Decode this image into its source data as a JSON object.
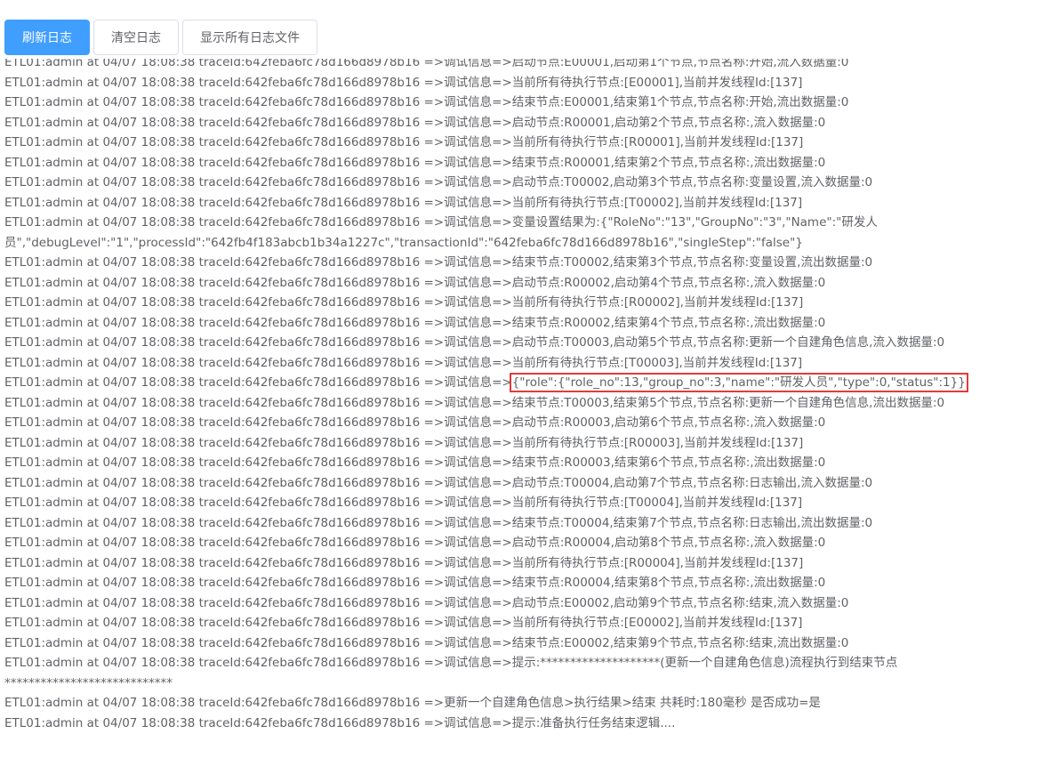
{
  "toolbar": {
    "refresh_label": "刷新日志",
    "clear_label": "清空日志",
    "show_all_label": "显示所有日志文件",
    "primary_color": "#409eff"
  },
  "log": {
    "highlight_color": "#e33b3b",
    "line_prefix": "ETL01:admin at 04/07 18:08:38 traceId:642feba6fc78d166d8978b16 =>",
    "highlight_text": "{\"role\":{\"role_no\":13,\"group_no\":3,\"name\":\"研发人员\",\"type\":0,\"status\":1}}",
    "lines": [
      "ETL01:admin at 04/07 18:08:38 traceId:642feba6fc78d166d8978b16 =>调试信息=>启动节点:E00001,启动第1个节点,节点名称:开始,流入数据量:0",
      "ETL01:admin at 04/07 18:08:38 traceId:642feba6fc78d166d8978b16 =>调试信息=>当前所有待执行节点:[E00001],当前并发线程Id:[137]",
      "ETL01:admin at 04/07 18:08:38 traceId:642feba6fc78d166d8978b16 =>调试信息=>结束节点:E00001,结束第1个节点,节点名称:开始,流出数据量:0",
      "ETL01:admin at 04/07 18:08:38 traceId:642feba6fc78d166d8978b16 =>调试信息=>启动节点:R00001,启动第2个节点,节点名称:,流入数据量:0",
      "ETL01:admin at 04/07 18:08:38 traceId:642feba6fc78d166d8978b16 =>调试信息=>当前所有待执行节点:[R00001],当前并发线程Id:[137]",
      "ETL01:admin at 04/07 18:08:38 traceId:642feba6fc78d166d8978b16 =>调试信息=>结束节点:R00001,结束第2个节点,节点名称:,流出数据量:0",
      "ETL01:admin at 04/07 18:08:38 traceId:642feba6fc78d166d8978b16 =>调试信息=>启动节点:T00002,启动第3个节点,节点名称:变量设置,流入数据量:0",
      "ETL01:admin at 04/07 18:08:38 traceId:642feba6fc78d166d8978b16 =>调试信息=>当前所有待执行节点:[T00002],当前并发线程Id:[137]",
      "ETL01:admin at 04/07 18:08:38 traceId:642feba6fc78d166d8978b16 =>调试信息=>变量设置结果为:{\"RoleNo\":\"13\",\"GroupNo\":\"3\",\"Name\":\"研发人",
      "员\",\"debugLevel\":\"1\",\"processId\":\"642fb4f183abcb1b34a1227c\",\"transactionId\":\"642feba6fc78d166d8978b16\",\"singleStep\":\"false\"}",
      "ETL01:admin at 04/07 18:08:38 traceId:642feba6fc78d166d8978b16 =>调试信息=>结束节点:T00002,结束第3个节点,节点名称:变量设置,流出数据量:0",
      "ETL01:admin at 04/07 18:08:38 traceId:642feba6fc78d166d8978b16 =>调试信息=>启动节点:R00002,启动第4个节点,节点名称:,流入数据量:0",
      "ETL01:admin at 04/07 18:08:38 traceId:642feba6fc78d166d8978b16 =>调试信息=>当前所有待执行节点:[R00002],当前并发线程Id:[137]",
      "ETL01:admin at 04/07 18:08:38 traceId:642feba6fc78d166d8978b16 =>调试信息=>结束节点:R00002,结束第4个节点,节点名称:,流出数据量:0",
      "ETL01:admin at 04/07 18:08:38 traceId:642feba6fc78d166d8978b16 =>调试信息=>启动节点:T00003,启动第5个节点,节点名称:更新一个自建角色信息,流入数据量:0",
      "ETL01:admin at 04/07 18:08:38 traceId:642feba6fc78d166d8978b16 =>调试信息=>当前所有待执行节点:[T00003],当前并发线程Id:[137]",
      "__HIGHLIGHT__",
      "ETL01:admin at 04/07 18:08:38 traceId:642feba6fc78d166d8978b16 =>调试信息=>结束节点:T00003,结束第5个节点,节点名称:更新一个自建角色信息,流出数据量:0",
      "ETL01:admin at 04/07 18:08:38 traceId:642feba6fc78d166d8978b16 =>调试信息=>启动节点:R00003,启动第6个节点,节点名称:,流入数据量:0",
      "ETL01:admin at 04/07 18:08:38 traceId:642feba6fc78d166d8978b16 =>调试信息=>当前所有待执行节点:[R00003],当前并发线程Id:[137]",
      "ETL01:admin at 04/07 18:08:38 traceId:642feba6fc78d166d8978b16 =>调试信息=>结束节点:R00003,结束第6个节点,节点名称:,流出数据量:0",
      "ETL01:admin at 04/07 18:08:38 traceId:642feba6fc78d166d8978b16 =>调试信息=>启动节点:T00004,启动第7个节点,节点名称:日志输出,流入数据量:0",
      "ETL01:admin at 04/07 18:08:38 traceId:642feba6fc78d166d8978b16 =>调试信息=>当前所有待执行节点:[T00004],当前并发线程Id:[137]",
      "ETL01:admin at 04/07 18:08:38 traceId:642feba6fc78d166d8978b16 =>调试信息=>结束节点:T00004,结束第7个节点,节点名称:日志输出,流出数据量:0",
      "ETL01:admin at 04/07 18:08:38 traceId:642feba6fc78d166d8978b16 =>调试信息=>启动节点:R00004,启动第8个节点,节点名称:,流入数据量:0",
      "ETL01:admin at 04/07 18:08:38 traceId:642feba6fc78d166d8978b16 =>调试信息=>当前所有待执行节点:[R00004],当前并发线程Id:[137]",
      "ETL01:admin at 04/07 18:08:38 traceId:642feba6fc78d166d8978b16 =>调试信息=>结束节点:R00004,结束第8个节点,节点名称:,流出数据量:0",
      "ETL01:admin at 04/07 18:08:38 traceId:642feba6fc78d166d8978b16 =>调试信息=>启动节点:E00002,启动第9个节点,节点名称:结束,流入数据量:0",
      "ETL01:admin at 04/07 18:08:38 traceId:642feba6fc78d166d8978b16 =>调试信息=>当前所有待执行节点:[E00002],当前并发线程Id:[137]",
      "ETL01:admin at 04/07 18:08:38 traceId:642feba6fc78d166d8978b16 =>调试信息=>结束节点:E00002,结束第9个节点,节点名称:结束,流出数据量:0",
      "ETL01:admin at 04/07 18:08:38 traceId:642feba6fc78d166d8978b16 =>调试信息=>提示:********************(更新一个自建角色信息)流程执行到结束节点",
      "****************************",
      "ETL01:admin at 04/07 18:08:38 traceId:642feba6fc78d166d8978b16 =>更新一个自建角色信息>执行结果>结束 共耗时:180毫秒 是否成功=是",
      "ETL01:admin at 04/07 18:08:38 traceId:642feba6fc78d166d8978b16 =>调试信息=>提示:准备执行任务结束逻辑...."
    ]
  }
}
